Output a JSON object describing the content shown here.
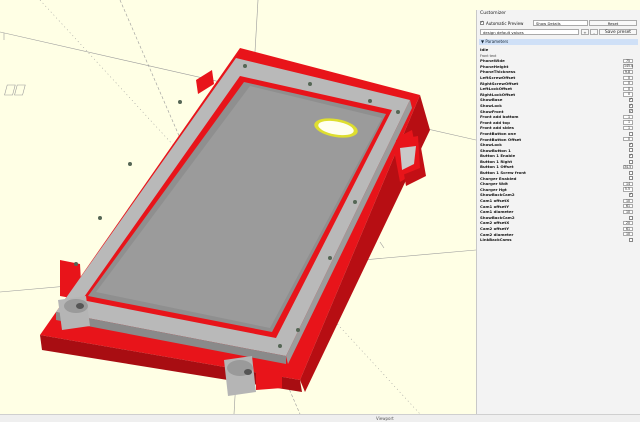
{
  "panel": {
    "title": "Customizer",
    "auto_preview_label": "Automatic Preview",
    "auto_preview_checked": "✓",
    "show_details": "Show Details",
    "reset_label": "Reset",
    "preset": "design default values",
    "plus": "+",
    "minus": "-",
    "save_preset": "Save preset",
    "section": "Parameters",
    "params": [
      {
        "label": "Idle",
        "kind": "none"
      },
      {
        "label": "Front text",
        "kind": "sub"
      },
      {
        "label": "PhoneWide",
        "kind": "val",
        "value": "75"
      },
      {
        "label": "PhoneHeight",
        "kind": "val",
        "value": "145.0"
      },
      {
        "label": "PhoneThickness",
        "kind": "val",
        "value": "9.8"
      },
      {
        "label": "LeftScrewOffset",
        "kind": "val",
        "value": "0"
      },
      {
        "label": "RightScrewOffset",
        "kind": "val",
        "value": "0"
      },
      {
        "label": "LeftLockOffset",
        "kind": "val",
        "value": "0"
      },
      {
        "label": "RightLockOffset",
        "kind": "val",
        "value": "0"
      },
      {
        "label": "ShowBase",
        "kind": "check",
        "value": "✓"
      },
      {
        "label": "ShowLock",
        "kind": "check",
        "value": "✓"
      },
      {
        "label": "ShowFront",
        "kind": "check",
        "value": "✓"
      },
      {
        "label": "Front add bottom",
        "kind": "val",
        "value": "1"
      },
      {
        "label": "Front add top",
        "kind": "val",
        "value": "1"
      },
      {
        "label": "Front add sides",
        "kind": "val",
        "value": "1"
      },
      {
        "label": "FrontButton one",
        "kind": "check",
        "value": ""
      },
      {
        "label": "FrontButton Offset",
        "kind": "val",
        "value": "0"
      },
      {
        "label": "ShowLock",
        "kind": "check",
        "value": "✓"
      },
      {
        "label": "ShowButton 1",
        "kind": "check",
        "value": ""
      },
      {
        "label": "Button 1 Enable",
        "kind": "check",
        "value": "✓"
      },
      {
        "label": "Button 1 Right",
        "kind": "check",
        "value": ""
      },
      {
        "label": "Button 1 Offset",
        "kind": "val",
        "value": "34.5"
      },
      {
        "label": "Button 1 Screw front",
        "kind": "check",
        "value": ""
      },
      {
        "label": "Charger Enabled",
        "kind": "check",
        "value": ""
      },
      {
        "label": "Charger Wdt",
        "kind": "val",
        "value": "14"
      },
      {
        "label": "Charger Hgt",
        "kind": "val",
        "value": "5.5"
      },
      {
        "label": "ShowBackCam2",
        "kind": "check",
        "value": "✓"
      },
      {
        "label": "Cam1 offsetX",
        "kind": "val",
        "value": "10"
      },
      {
        "label": "Cam1 offsetY",
        "kind": "val",
        "value": "61"
      },
      {
        "label": "Cam1 diameter",
        "kind": "val",
        "value": "10"
      },
      {
        "label": "ShowBackCam2",
        "kind": "check",
        "value": ""
      },
      {
        "label": "Cam2 offsetX",
        "kind": "val",
        "value": "20"
      },
      {
        "label": "Cam2 offsetY",
        "kind": "val",
        "value": "61"
      },
      {
        "label": "Cam2 diameter",
        "kind": "val",
        "value": "10"
      },
      {
        "label": "LinkBackCams",
        "kind": "check",
        "value": ""
      }
    ]
  },
  "status": {
    "left": "",
    "right": "Viewport"
  },
  "colors": {
    "background": "#ffffe5",
    "red": "#e8141a",
    "frame": "#a9a9a9",
    "screen": "#8e8e8e",
    "grey": "#bcbcbc"
  }
}
